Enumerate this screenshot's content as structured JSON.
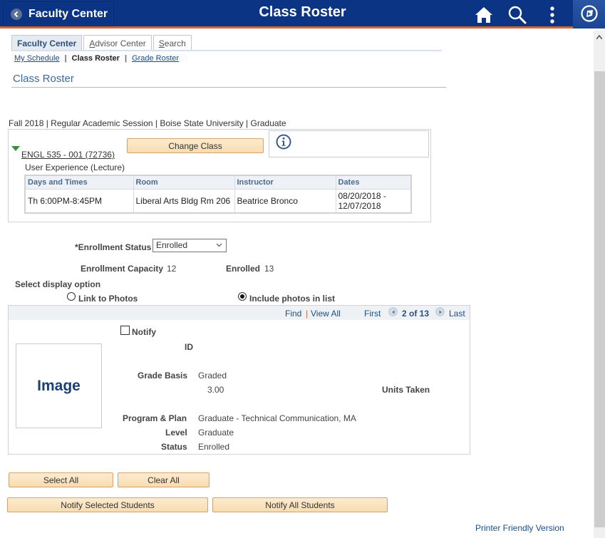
{
  "header": {
    "back_label": "Faculty Center",
    "title": "Class Roster",
    "icons": [
      "home-icon",
      "search-icon",
      "more-vertical-icon",
      "navbar-compass-icon"
    ]
  },
  "tabs": [
    {
      "label": "Faculty Center",
      "active": true
    },
    {
      "label": "Advisor Center",
      "active": false,
      "accesskey": "A"
    },
    {
      "label": "Search",
      "active": false,
      "accesskey": "S"
    }
  ],
  "subnav": {
    "items": [
      {
        "label": "My Schedule",
        "link": true
      },
      {
        "label": "Class Roster",
        "link": false
      },
      {
        "label": "Grade Roster",
        "link": true
      }
    ],
    "separator": "|"
  },
  "section_title": "Class Roster",
  "term_line": "Fall 2018 | Regular Academic Session | Boise State University | Graduate",
  "class": {
    "link": "ENGL 535 - 001 (72736)",
    "description": "User Experience (Lecture)",
    "change_button": "Change Class",
    "info_icon": "info-icon",
    "meetings": {
      "headers": [
        "Days and Times",
        "Room",
        "Instructor",
        "Dates"
      ],
      "rows": [
        [
          "Th 6:00PM-8:45PM",
          "Liberal Arts Bldg Rm 206",
          "Beatrice Bronco",
          "08/20/2018 - 12/07/2018"
        ]
      ]
    }
  },
  "enrollment": {
    "status_label": "*Enrollment Status",
    "status_value": "Enrolled",
    "capacity_label": "Enrollment Capacity",
    "capacity_value": "12",
    "enrolled_label": "Enrolled",
    "enrolled_value": "13"
  },
  "display_option": {
    "label": "Select display option",
    "options": [
      {
        "label": "Link to Photos",
        "selected": false
      },
      {
        "label": "Include photos in list",
        "selected": true
      }
    ]
  },
  "grid": {
    "find": "Find",
    "view_all": "View All",
    "first": "First",
    "position": "2 of 13",
    "last": "Last",
    "student": {
      "notify_label": "Notify",
      "notify_checked": false,
      "photo_text": "Image",
      "id_label": "ID",
      "id_value": "",
      "grade_basis_label": "Grade Basis",
      "grade_basis_value": "Graded",
      "units_value": "3.00",
      "units_label": "Units Taken",
      "program_label": "Program & Plan",
      "program_value": "Graduate - Technical Communication, MA",
      "level_label": "Level",
      "level_value": "Graduate",
      "status_label": "Status",
      "status_value": "Enrolled"
    }
  },
  "buttons": {
    "select_all": "Select All",
    "clear_all": "Clear All",
    "notify_selected": "Notify Selected Students",
    "notify_all": "Notify All Students"
  },
  "printer_link": "Printer Friendly Version",
  "colors": {
    "header_bg": "#0b3584",
    "header_accent": "#d9652a",
    "link": "#1c4f8c",
    "button_bg": "#fbe3c0"
  }
}
